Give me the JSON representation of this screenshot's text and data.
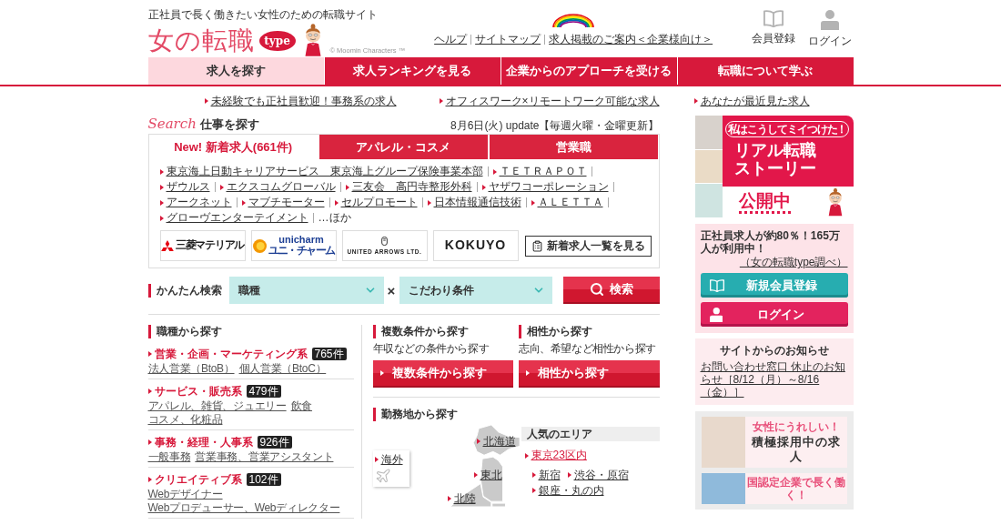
{
  "header": {
    "tagline": "正社員で長く働きたい女性のための転職サイト",
    "logo": "女の転職",
    "logo_badge": "type",
    "copyright": "© Moomin Characters ™",
    "links": [
      "ヘルプ",
      "サイトマップ",
      "求人掲載のご案内＜企業様向け＞"
    ],
    "actions": [
      {
        "kind": "register",
        "label": "会員登録"
      },
      {
        "kind": "login",
        "label": "ログイン"
      }
    ]
  },
  "nav": [
    {
      "label": "求人を探す",
      "selected": true
    },
    {
      "label": "求人ランキングを見る",
      "selected": false
    },
    {
      "label": "企業からのアプローチを受ける",
      "selected": false
    },
    {
      "label": "転職について学ぶ",
      "selected": false
    }
  ],
  "promo_links": [
    "未経験でも正社員歓迎！事務系の求人",
    "オフィスワーク×リモートワーク可能な求人",
    "あなたが最近見た求人"
  ],
  "search": {
    "script_title": "Search",
    "title": "仕事を探す",
    "update": "8月6日(火) update【毎週火曜・金曜更新】",
    "tabs": [
      {
        "label": "New! 新着求人(661件)",
        "selected": true
      },
      {
        "label": "アパレル・コスメ",
        "selected": false
      },
      {
        "label": "営業職",
        "selected": false
      }
    ],
    "companies": [
      "東京海上日動キャリアサービス　東京海上グループ保険事業本部",
      "ＴＥＴＲＡＰＯＴ",
      "ザウルス",
      "エクスコムグローバル",
      "三友会　高円寺整形外科",
      "ヤザワコーポレーション",
      "アークネット",
      "マブチモーター",
      "セルプロモート",
      "日本情報通信技術",
      "ＡＬＥＴＴＡ",
      "グローヴエンターテイメント"
    ],
    "more": "…ほか",
    "logos": [
      {
        "kind": "mitsubishi",
        "name": "三菱マテリアル"
      },
      {
        "kind": "unicharm",
        "name": "unicharm",
        "sub": "ユニ・チャーム"
      },
      {
        "kind": "united_arrows",
        "name": "UNITED ARROWS LTD."
      },
      {
        "kind": "kokuyo",
        "name": "KOKUYO"
      }
    ],
    "list_button": "新着求人一覧を見る"
  },
  "quick_search": {
    "label": "かんたん検索",
    "selects": [
      {
        "value": "職種"
      },
      {
        "value": "こだわり条件"
      }
    ],
    "joiner": "×",
    "button": "検索"
  },
  "job_types": {
    "heading": "職種から探す",
    "items": [
      {
        "title": "営業・企画・マーケティング系",
        "count": "765件",
        "subs": [
          "法人営業（BtoB）",
          "個人営業（BtoC）"
        ]
      },
      {
        "title": "サービス・販売系",
        "count": "479件",
        "subs": [
          "アパレル、雑貨、ジュエリー",
          "飲食",
          "コスメ、化粧品"
        ]
      },
      {
        "title": "事務・経理・人事系",
        "count": "926件",
        "subs": [
          "一般事務",
          "営業事務、営業アシスタント"
        ]
      },
      {
        "title": "クリエイティブ系",
        "count": "102件",
        "subs": [
          "Webデザイナー",
          "Webプロデューサー、Webディレクター"
        ]
      }
    ]
  },
  "other_searches": [
    {
      "heading": "複数条件から探す",
      "desc": "年収などの条件から探す",
      "button": "複数条件から探す"
    },
    {
      "heading": "相性から探す",
      "desc": "志向、希望など相性から探す",
      "button": "相性から探す"
    }
  ],
  "location": {
    "heading": "勤務地から探す",
    "regions": [
      "北海道",
      "東北",
      "北陸"
    ],
    "overseas": "海外",
    "popular_title": "人気のエリア",
    "popular_main": "東京23区内",
    "popular_subs": [
      "新宿",
      "渋谷・原宿",
      "銀座・丸の内"
    ]
  },
  "sidebar": {
    "banner": {
      "badge": "私はこうしてミイつけた！",
      "title_lines": [
        "リアル転職",
        "ストーリー"
      ],
      "status": "公開中"
    },
    "member": {
      "text": "正社員求人が約80％！165万人が利用中！",
      "source": "（女の転職type調べ）",
      "buttons": [
        {
          "kind": "register",
          "label": "新規会員登録"
        },
        {
          "kind": "login",
          "label": "ログイン"
        }
      ]
    },
    "notice": {
      "title": "サイトからのお知らせ",
      "link": "お問い合わせ窓口 休止のお知らせ［8/12（月）～8/16（金）］"
    },
    "features": [
      {
        "kicker": "女性にうれしい！",
        "title": "積極採用中の求人"
      },
      {
        "kicker": "国認定企業で長く働く！"
      }
    ]
  }
}
